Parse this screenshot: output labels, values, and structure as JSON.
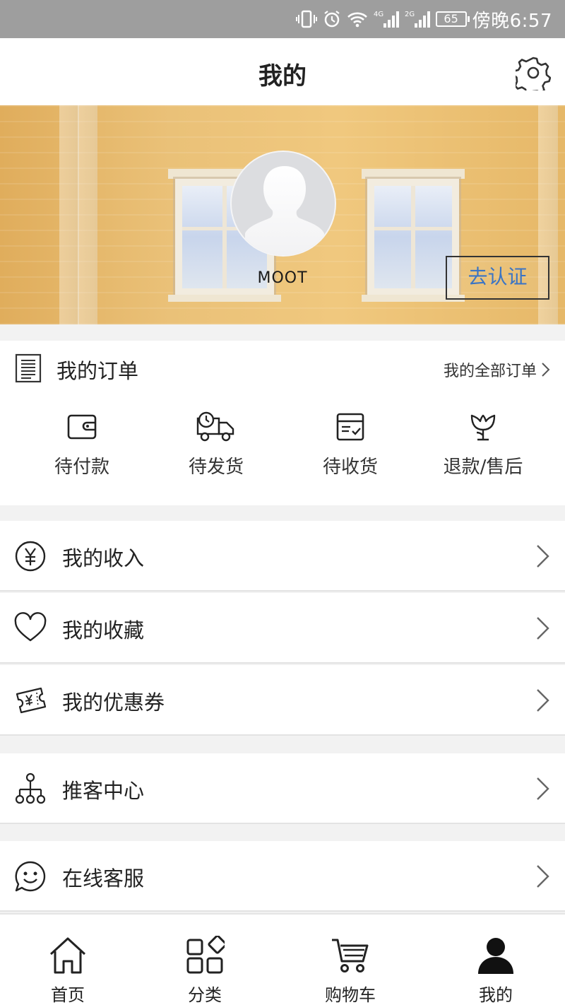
{
  "status_bar": {
    "battery": "65",
    "network_1": "4G",
    "network_2": "2G",
    "time": "傍晚6:57"
  },
  "header": {
    "title": "我的",
    "settings_icon": "gear-icon"
  },
  "profile": {
    "username": "MOOT",
    "verify_label": "去认证"
  },
  "orders": {
    "title": "我的订单",
    "view_all": "我的全部订单",
    "statuses": [
      {
        "label": "待付款",
        "icon": "wallet-icon"
      },
      {
        "label": "待发货",
        "icon": "truck-icon"
      },
      {
        "label": "待收货",
        "icon": "package-icon"
      },
      {
        "label": "退款/售后",
        "icon": "tulip-icon"
      }
    ]
  },
  "menu": {
    "items": [
      {
        "label": "我的收入",
        "icon": "yen-icon"
      },
      {
        "label": "我的收藏",
        "icon": "heart-icon"
      },
      {
        "label": "我的优惠券",
        "icon": "coupon-icon"
      },
      {
        "label": "推客中心",
        "icon": "network-icon"
      },
      {
        "label": "在线客服",
        "icon": "smile-chat-icon"
      }
    ]
  },
  "bottom_nav": {
    "items": [
      {
        "label": "首页",
        "icon": "home-icon"
      },
      {
        "label": "分类",
        "icon": "category-icon"
      },
      {
        "label": "购物车",
        "icon": "cart-icon"
      },
      {
        "label": "我的",
        "icon": "user-icon",
        "active": true
      }
    ]
  }
}
